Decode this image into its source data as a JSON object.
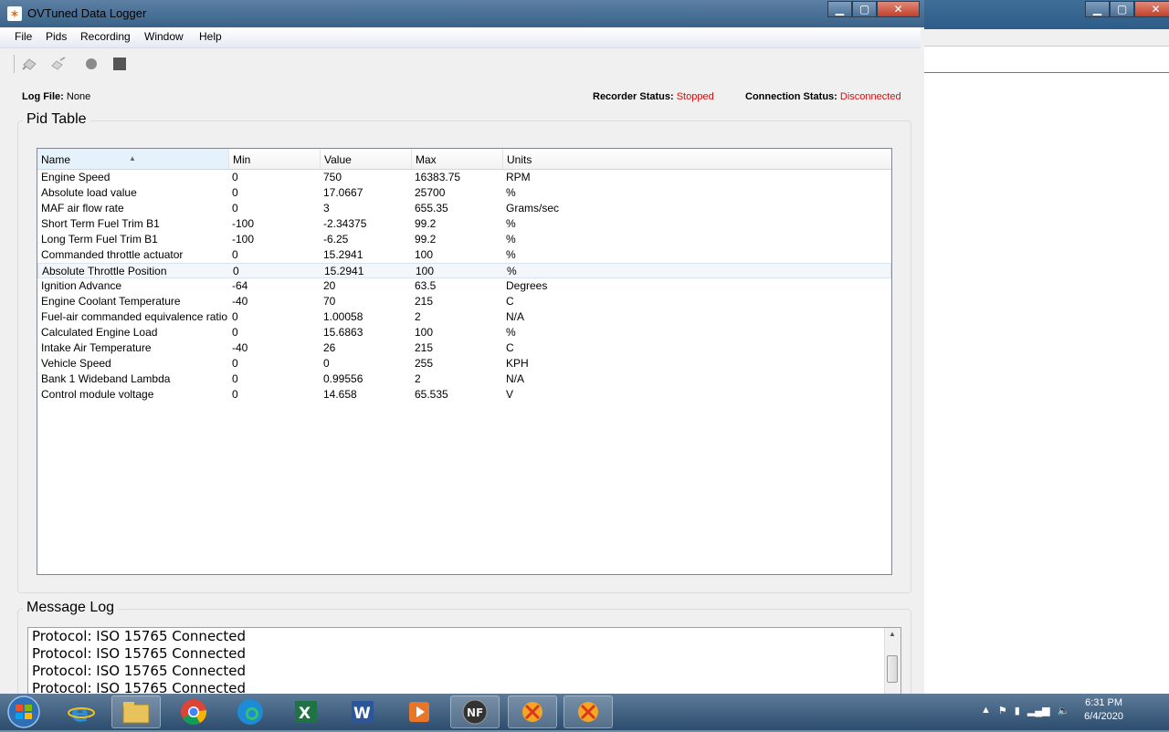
{
  "window": {
    "title": "OVTuned Data Logger"
  },
  "menu": [
    "File",
    "Pids",
    "Recording",
    "Window",
    "Help"
  ],
  "status": {
    "log_file_label": "Log File:",
    "log_file_value": "None",
    "recorder_label": "Recorder Status:",
    "recorder_value": "Stopped",
    "connection_label": "Connection Status:",
    "connection_value": "Disconnected"
  },
  "pid_table": {
    "title": "Pid Table",
    "columns": [
      "Name",
      "Min",
      "Value",
      "Max",
      "Units"
    ],
    "rows": [
      [
        "Engine Speed",
        "0",
        "750",
        "16383.75",
        "RPM"
      ],
      [
        "Absolute load value",
        "0",
        "17.0667",
        "25700",
        "%"
      ],
      [
        "MAF air flow rate",
        "0",
        "3",
        "655.35",
        "Grams/sec"
      ],
      [
        "Short Term Fuel Trim B1",
        "-100",
        "-2.34375",
        "99.2",
        "%"
      ],
      [
        "Long Term Fuel Trim B1",
        "-100",
        "-6.25",
        "99.2",
        "%"
      ],
      [
        "Commanded throttle actuator",
        "0",
        "15.2941",
        "100",
        "%"
      ],
      [
        "Absolute Throttle Position",
        "0",
        "15.2941",
        "100",
        "%"
      ],
      [
        "Ignition Advance",
        "-64",
        "20",
        "63.5",
        "Degrees"
      ],
      [
        "Engine Coolant Temperature",
        "-40",
        "70",
        "215",
        "C"
      ],
      [
        "Fuel-air commanded equivalence ratio",
        "0",
        "1.00058",
        "2",
        "N/A"
      ],
      [
        "Calculated Engine Load",
        "0",
        "15.6863",
        "100",
        "%"
      ],
      [
        "Intake Air Temperature",
        "-40",
        "26",
        "215",
        "C"
      ],
      [
        "Vehicle Speed",
        "0",
        "0",
        "255",
        "KPH"
      ],
      [
        "Bank 1 Wideband Lambda",
        "0",
        "0.99556",
        "2",
        "N/A"
      ],
      [
        "Control module voltage",
        "0",
        "14.658",
        "65.535",
        "V"
      ]
    ],
    "selected_row": 6
  },
  "message_log": {
    "title": "Message Log",
    "lines": [
      "Protocol: ISO 15765 Connected",
      "Protocol: ISO 15765 Connected",
      "Protocol: ISO 15765 Connected",
      "Protocol: ISO 15765 Connected"
    ]
  },
  "taskbar": {
    "time": "6:31 PM",
    "date": "6/4/2020",
    "apps": [
      "internet-explorer",
      "file-explorer",
      "chrome",
      "edge",
      "excel",
      "word",
      "media-player",
      "nf-app",
      "ovtuned-app",
      "ovtuned-app"
    ]
  },
  "colors": {
    "status_red": "#d01010",
    "title_blue": "#3a6389"
  }
}
